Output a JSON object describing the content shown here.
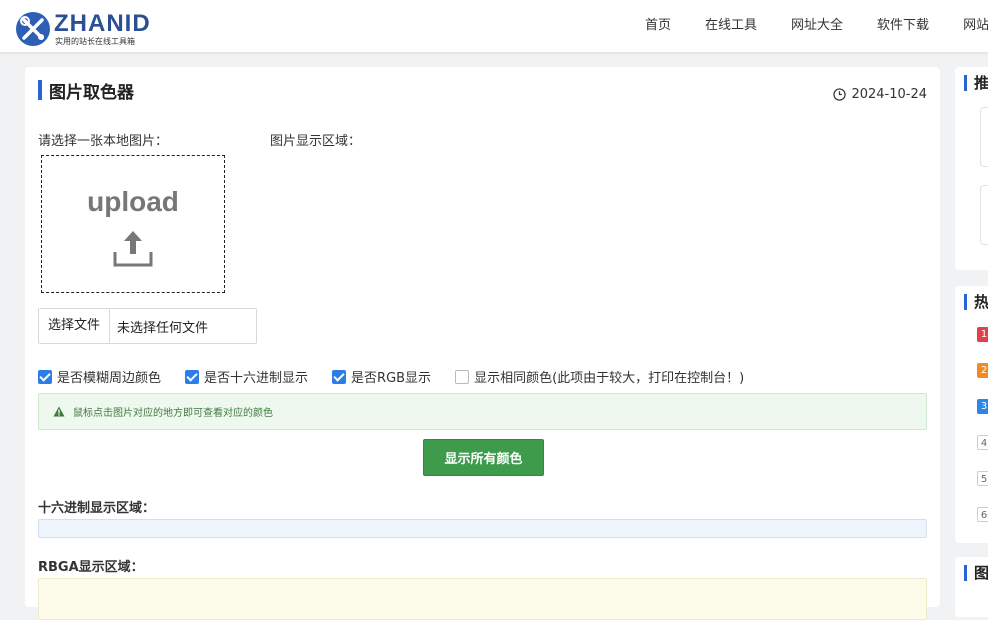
{
  "header": {
    "logo_text": "ZHANID",
    "logo_subtitle": "实用的站长在线工具箱",
    "nav": [
      "首页",
      "在线工具",
      "网址大全",
      "软件下载",
      "网站"
    ]
  },
  "page": {
    "title": "图片取色器",
    "date": "2024-10-24",
    "select_label": "请选择一张本地图片：",
    "display_label": "图片显示区域：",
    "upload_text": "upload",
    "file_button": "选择文件",
    "file_status": "未选择任何文件",
    "checkboxes": [
      {
        "label": "是否模糊周边颜色",
        "checked": true
      },
      {
        "label": "是否十六进制显示",
        "checked": true
      },
      {
        "label": "是否RGB显示",
        "checked": true
      },
      {
        "label": "显示相同颜色(此项由于较大，打印在控制台！)",
        "checked": false
      }
    ],
    "tip": "鼠标点击图片对应的地方即可查看对应的颜色",
    "show_all_button": "显示所有颜色",
    "hex_section": "十六进制显示区域：",
    "rgba_section": "RBGA显示区域："
  },
  "sidebar": {
    "cards": [
      "推",
      "热",
      "图"
    ],
    "ranks": [
      "1",
      "2",
      "3",
      "4",
      "5",
      "6"
    ]
  },
  "colors": {
    "accent": "#2b62d6",
    "button_green": "#3d9b4b",
    "rank_1": "#e0414a",
    "rank_2": "#f08a24",
    "rank_3": "#2b86e8"
  }
}
